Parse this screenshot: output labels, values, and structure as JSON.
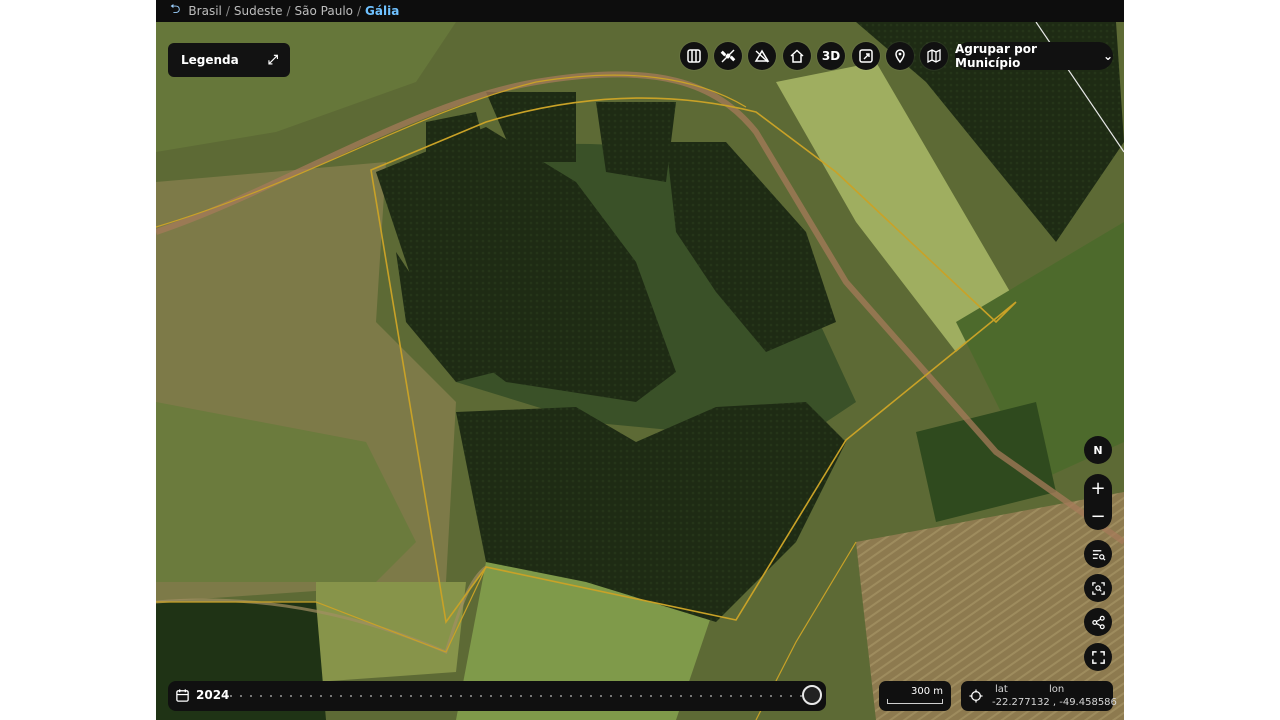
{
  "breadcrumb": {
    "back_icon": "undo-arrow-icon",
    "items": [
      "Brasil",
      "Sudeste",
      "São Paulo",
      "Gália"
    ],
    "separator": "/"
  },
  "legend": {
    "label": "Legenda",
    "expand_icon": "expand-arrows-icon"
  },
  "toolbar": {
    "icons": [
      "columns-icon",
      "satellite-icon",
      "no-terrain-icon",
      "home-icon",
      "3d-toggle",
      "export-map-icon",
      "location-pin-icon",
      "map-icon"
    ],
    "three_d_label": "3D",
    "group_select": {
      "value": "Agrupar por Município",
      "icon": "chevron-down-icon"
    }
  },
  "controls": {
    "compass_label": "N",
    "zoom_in": "+",
    "zoom_out": "−",
    "icons": [
      "list-search-icon",
      "focus-search-icon",
      "share-icon",
      "fullscreen-icon"
    ]
  },
  "timeline": {
    "year": "2024",
    "icon": "calendar-icon",
    "position": 1.0
  },
  "scale": {
    "label": "300 m"
  },
  "coordinates": {
    "lat_label": "lat",
    "lon_label": "lon",
    "value": "-22.277132 , -49.458586",
    "icon": "crosshair-icon"
  },
  "colors": {
    "panel": "#111111",
    "accent": "#6fc1ff",
    "forest": "#1f2c16",
    "pasture": "#6f7a3a",
    "boundary": "#c9a227"
  }
}
